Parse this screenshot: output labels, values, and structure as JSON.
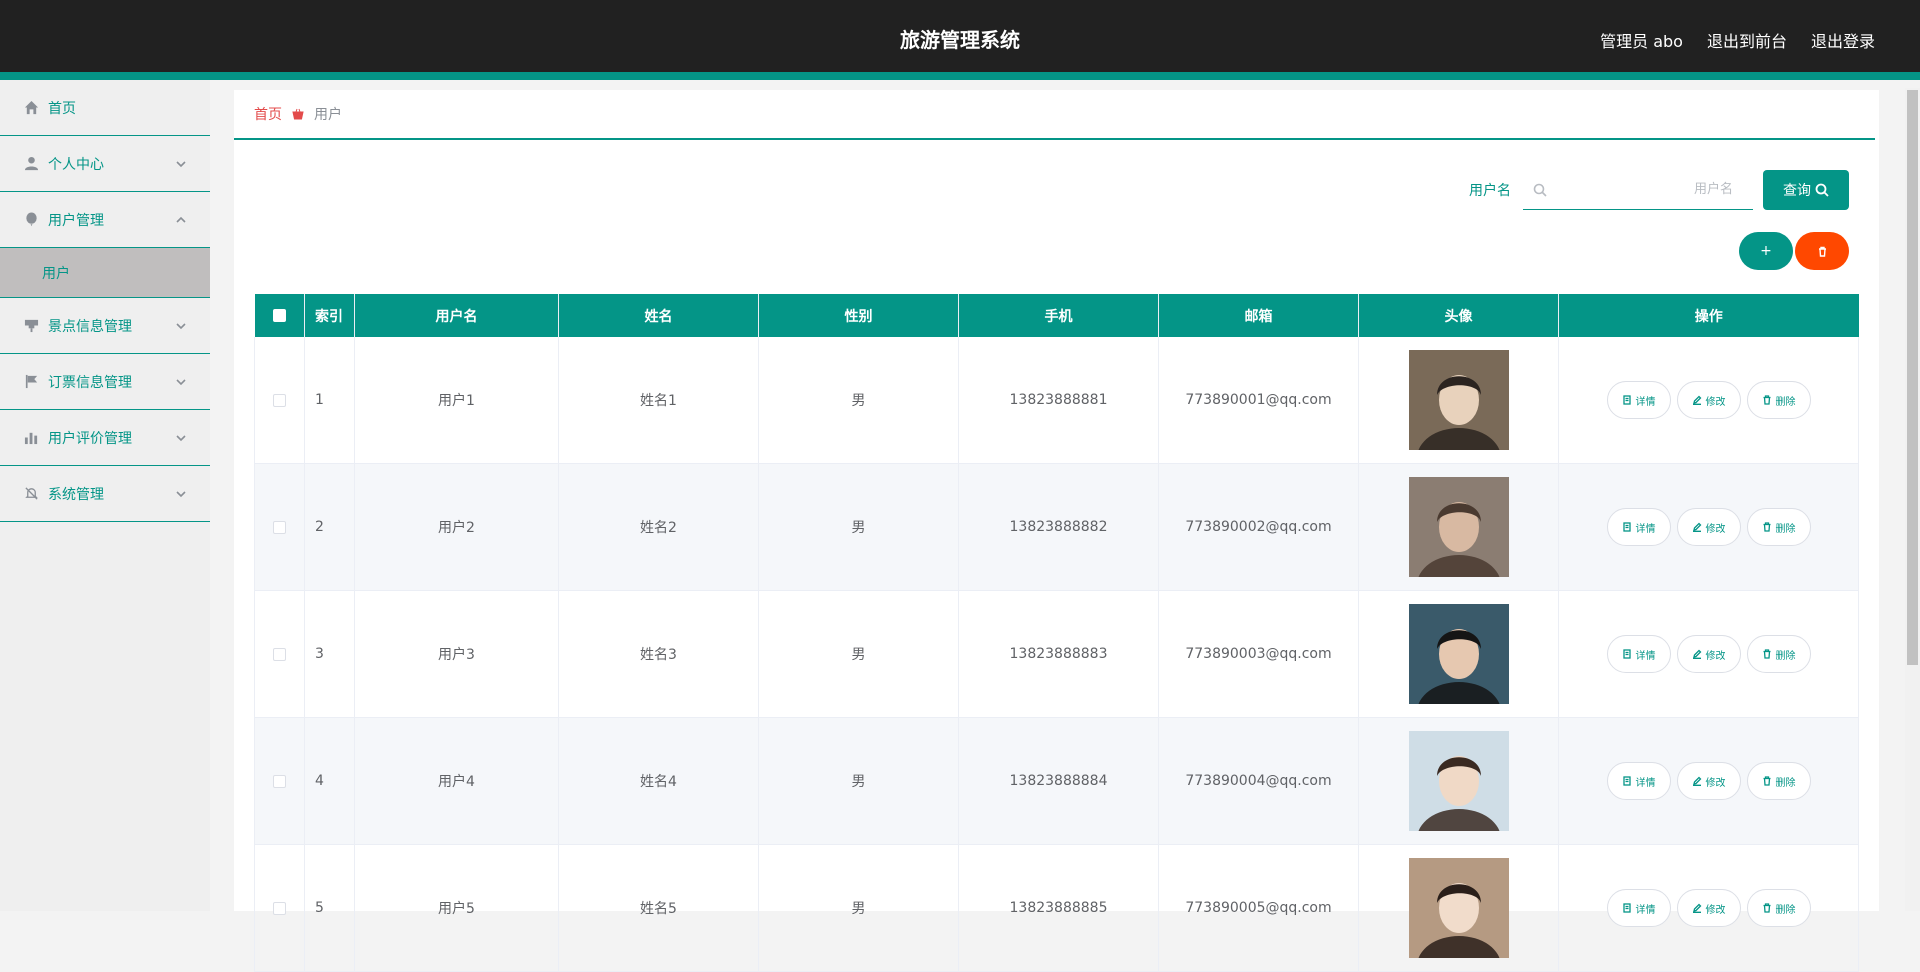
{
  "header": {
    "title": "旅游管理系统",
    "admin_label": "管理员 abo",
    "front_label": "退出到前台",
    "logout_label": "退出登录"
  },
  "sidebar": {
    "items": [
      {
        "label": "首页",
        "icon": "home-icon"
      },
      {
        "label": "个人中心",
        "icon": "user-icon"
      },
      {
        "label": "用户管理",
        "icon": "balloon-icon"
      },
      {
        "label": "景点信息管理",
        "icon": "sign-icon"
      },
      {
        "label": "订票信息管理",
        "icon": "flag-icon"
      },
      {
        "label": "用户评价管理",
        "icon": "bar-chart-icon"
      },
      {
        "label": "系统管理",
        "icon": "bell-off-icon"
      }
    ],
    "sub_item": "用户"
  },
  "breadcrumb": {
    "home": "首页",
    "current": "用户"
  },
  "search": {
    "label": "用户名",
    "placeholder": "用户名",
    "button": "查询"
  },
  "actions": {
    "add": "+"
  },
  "table": {
    "columns": [
      "索引",
      "用户名",
      "姓名",
      "性别",
      "手机",
      "邮箱",
      "头像",
      "操作"
    ],
    "rows": [
      {
        "index": "1",
        "username": "用户1",
        "name": "姓名1",
        "gender": "男",
        "phone": "13823888881",
        "email": "773890001@qq.com"
      },
      {
        "index": "2",
        "username": "用户2",
        "name": "姓名2",
        "gender": "男",
        "phone": "13823888882",
        "email": "773890002@qq.com"
      },
      {
        "index": "3",
        "username": "用户3",
        "name": "姓名3",
        "gender": "男",
        "phone": "13823888883",
        "email": "773890003@qq.com"
      },
      {
        "index": "4",
        "username": "用户4",
        "name": "姓名4",
        "gender": "男",
        "phone": "13823888884",
        "email": "773890004@qq.com"
      },
      {
        "index": "5",
        "username": "用户5",
        "name": "姓名5",
        "gender": "男",
        "phone": "13823888885",
        "email": "773890005@qq.com"
      }
    ],
    "ops": {
      "detail": "详情",
      "edit": "修改",
      "delete": "删除"
    }
  },
  "colors": {
    "primary": "#049587",
    "danger": "#ff4800",
    "header": "#212121"
  }
}
